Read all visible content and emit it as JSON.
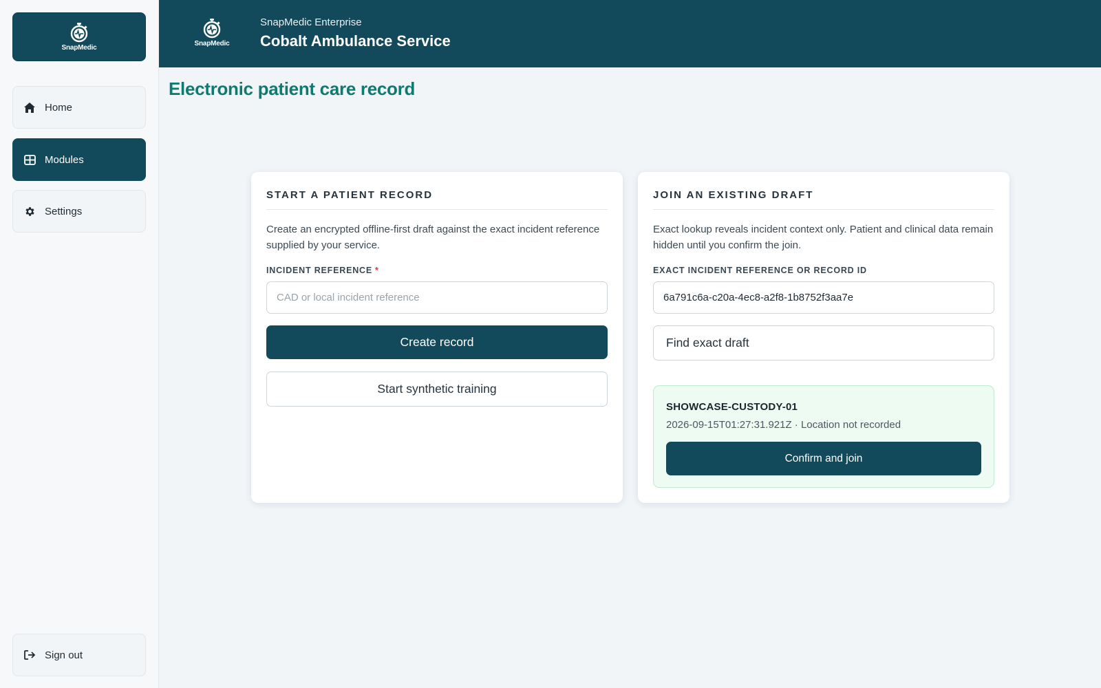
{
  "brand": {
    "logo_text": "SnapMedic"
  },
  "sidebar": {
    "items": [
      {
        "label": "Home",
        "icon": "home-icon"
      },
      {
        "label": "Modules",
        "icon": "grid-icon",
        "active": true
      },
      {
        "label": "Settings",
        "icon": "gear-icon"
      }
    ],
    "sign_out": {
      "label": "Sign out",
      "icon": "sign-out-icon"
    }
  },
  "header": {
    "subtitle": "SnapMedic Enterprise",
    "title": "Cobalt Ambulance Service"
  },
  "page": {
    "title": "Electronic patient care record"
  },
  "start_card": {
    "heading": "START A PATIENT RECORD",
    "description": "Create an encrypted offline-first draft against the exact incident reference supplied by your service.",
    "field_label": "INCIDENT REFERENCE",
    "required_marker": "*",
    "input_placeholder": "CAD or local incident reference",
    "input_value": "",
    "create_label": "Create record",
    "training_label": "Start synthetic training"
  },
  "join_card": {
    "heading": "JOIN AN EXISTING DRAFT",
    "description": "Exact lookup reveals incident context only. Patient and clinical data remain hidden until you confirm the join.",
    "field_label": "EXACT INCIDENT REFERENCE OR RECORD ID",
    "input_value": "6a791c6a-c20a-4ec8-a2f8-1b8752f3aa7e",
    "find_label": "Find exact draft",
    "result": {
      "id": "SHOWCASE-CUSTODY-01",
      "meta": "2026-09-15T01:27:31.921Z · Location not recorded",
      "confirm_label": "Confirm and join"
    }
  },
  "colors": {
    "primary": "#124a5c",
    "accent_title": "#0f7a6f",
    "result_bg": "#eefbf3",
    "required": "#d23b3b"
  }
}
